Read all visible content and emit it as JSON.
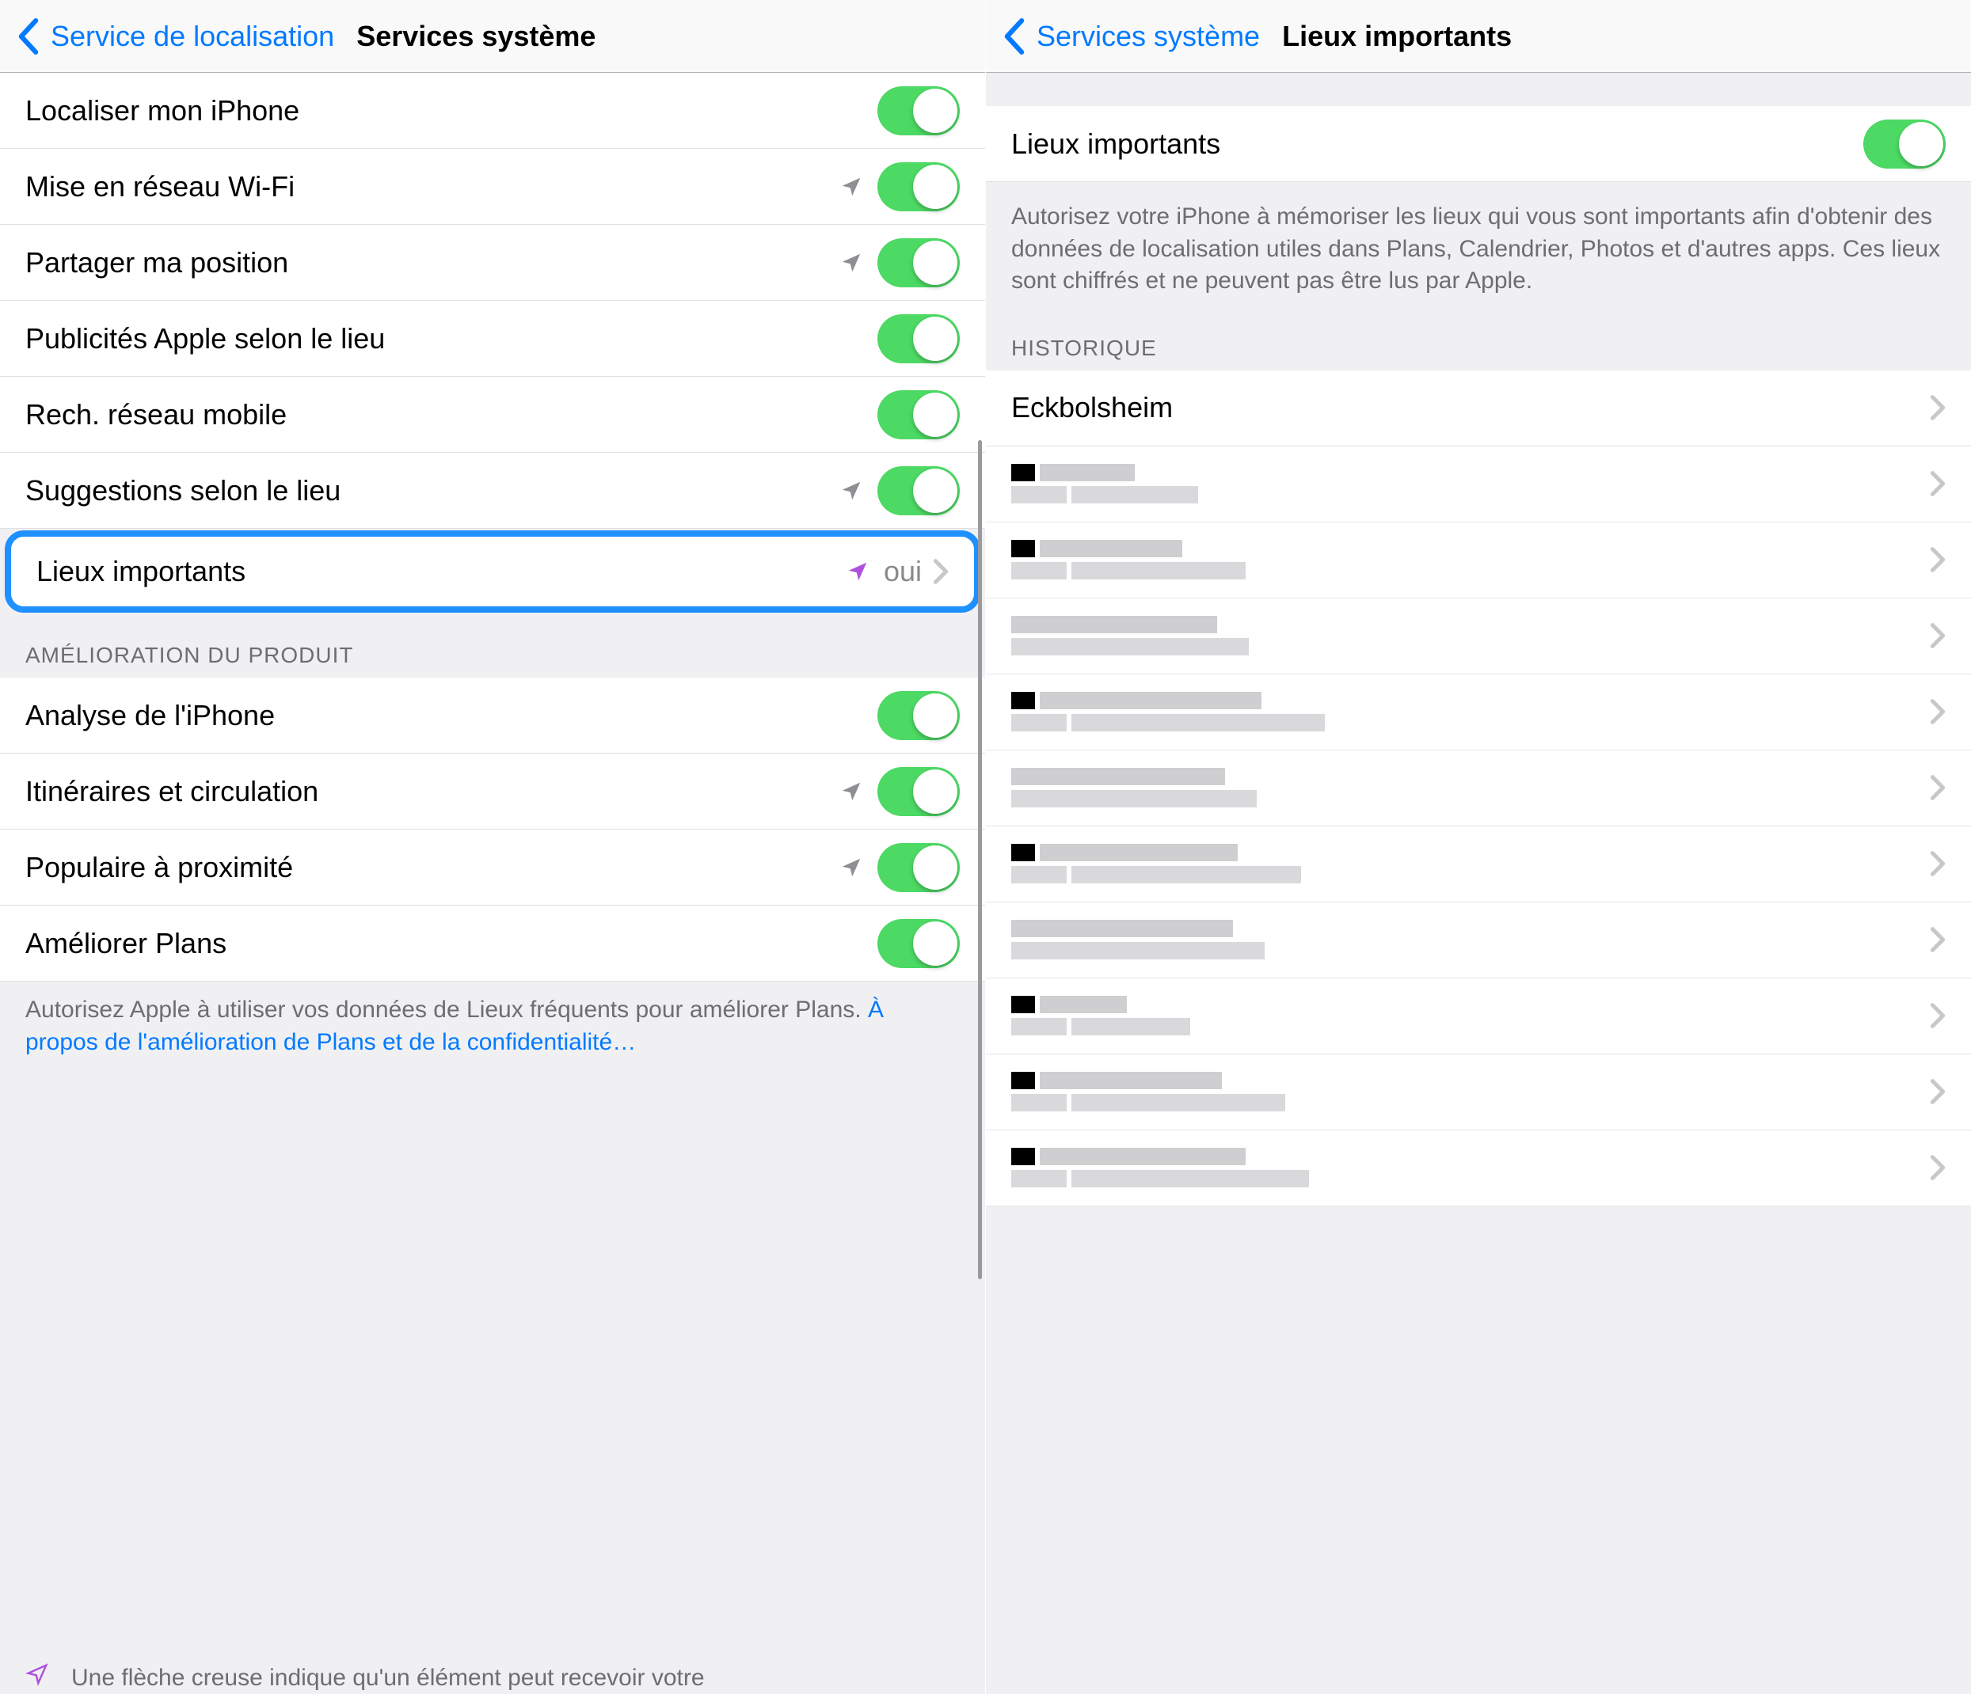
{
  "left": {
    "nav": {
      "back": "Service de localisation",
      "title": "Services système"
    },
    "items1": [
      {
        "label": "Localiser mon iPhone",
        "arrow": "none",
        "toggle": true
      },
      {
        "label": "Mise en réseau Wi-Fi",
        "arrow": "gray",
        "toggle": true
      },
      {
        "label": "Partager ma position",
        "arrow": "gray",
        "toggle": true
      },
      {
        "label": "Publicités Apple selon le lieu",
        "arrow": "none",
        "toggle": true
      },
      {
        "label": "Rech. réseau mobile",
        "arrow": "none",
        "toggle": true
      },
      {
        "label": "Suggestions selon le lieu",
        "arrow": "gray",
        "toggle": true
      }
    ],
    "highlightedRow": {
      "label": "Lieux importants",
      "arrow": "purple",
      "detail": "oui"
    },
    "section2Header": "AMÉLIORATION DU PRODUIT",
    "items2": [
      {
        "label": "Analyse de l'iPhone",
        "arrow": "none",
        "toggle": true
      },
      {
        "label": "Itinéraires et circulation",
        "arrow": "gray",
        "toggle": true
      },
      {
        "label": "Populaire à proximité",
        "arrow": "gray",
        "toggle": true
      },
      {
        "label": "Améliorer Plans",
        "arrow": "none",
        "toggle": true
      }
    ],
    "footer1a": "Autorisez Apple à utiliser vos données de Lieux fréquents pour améliorer Plans. ",
    "footer1link": "À propos de l'amélioration de Plans et de la confidentialité…",
    "footer2": "Une flèche creuse indique qu'un élément peut recevoir votre"
  },
  "right": {
    "nav": {
      "back": "Services système",
      "title": "Lieux importants"
    },
    "mainToggle": {
      "label": "Lieux importants",
      "toggle": true
    },
    "explain": "Autorisez votre iPhone à mémoriser les lieux qui vous sont importants afin d'obtenir des données de localisation utiles dans Plans, Calendrier, Photos et d'autres apps. Ces lieux sont chiffrés et ne peuvent pas être lus par Apple.",
    "historyHeader": "HISTORIQUE",
    "historyFirst": "Eckbolsheim",
    "blurredCount": 10
  }
}
